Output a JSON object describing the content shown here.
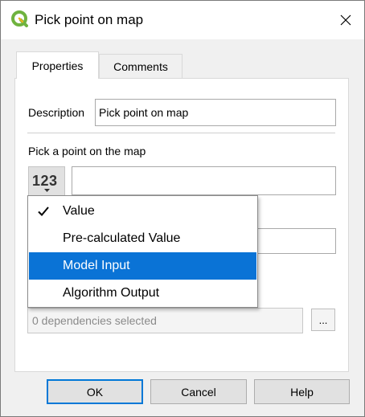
{
  "window": {
    "title": "Pick point on map",
    "icon": "qgis-logo-icon",
    "close_icon": "close-icon"
  },
  "tabs": [
    {
      "label": "Properties",
      "active": true
    },
    {
      "label": "Comments",
      "active": false
    }
  ],
  "description": {
    "label": "Description",
    "value": "Pick point on map"
  },
  "point": {
    "label": "Pick a point on the map",
    "type_button_text": "123",
    "value": ""
  },
  "hidden_field": {
    "value": ""
  },
  "dependencies": {
    "value": "0 dependencies selected",
    "button_label": "..."
  },
  "dropdown": {
    "items": [
      {
        "label": "Value",
        "checked": true,
        "selected": false
      },
      {
        "label": "Pre-calculated Value",
        "checked": false,
        "selected": false
      },
      {
        "label": "Model Input",
        "checked": false,
        "selected": true
      },
      {
        "label": "Algorithm Output",
        "checked": false,
        "selected": false
      }
    ]
  },
  "buttons": {
    "ok": "OK",
    "cancel": "Cancel",
    "help": "Help"
  },
  "colors": {
    "selection": "#0a73d6",
    "default_button_border": "#0078d7"
  }
}
